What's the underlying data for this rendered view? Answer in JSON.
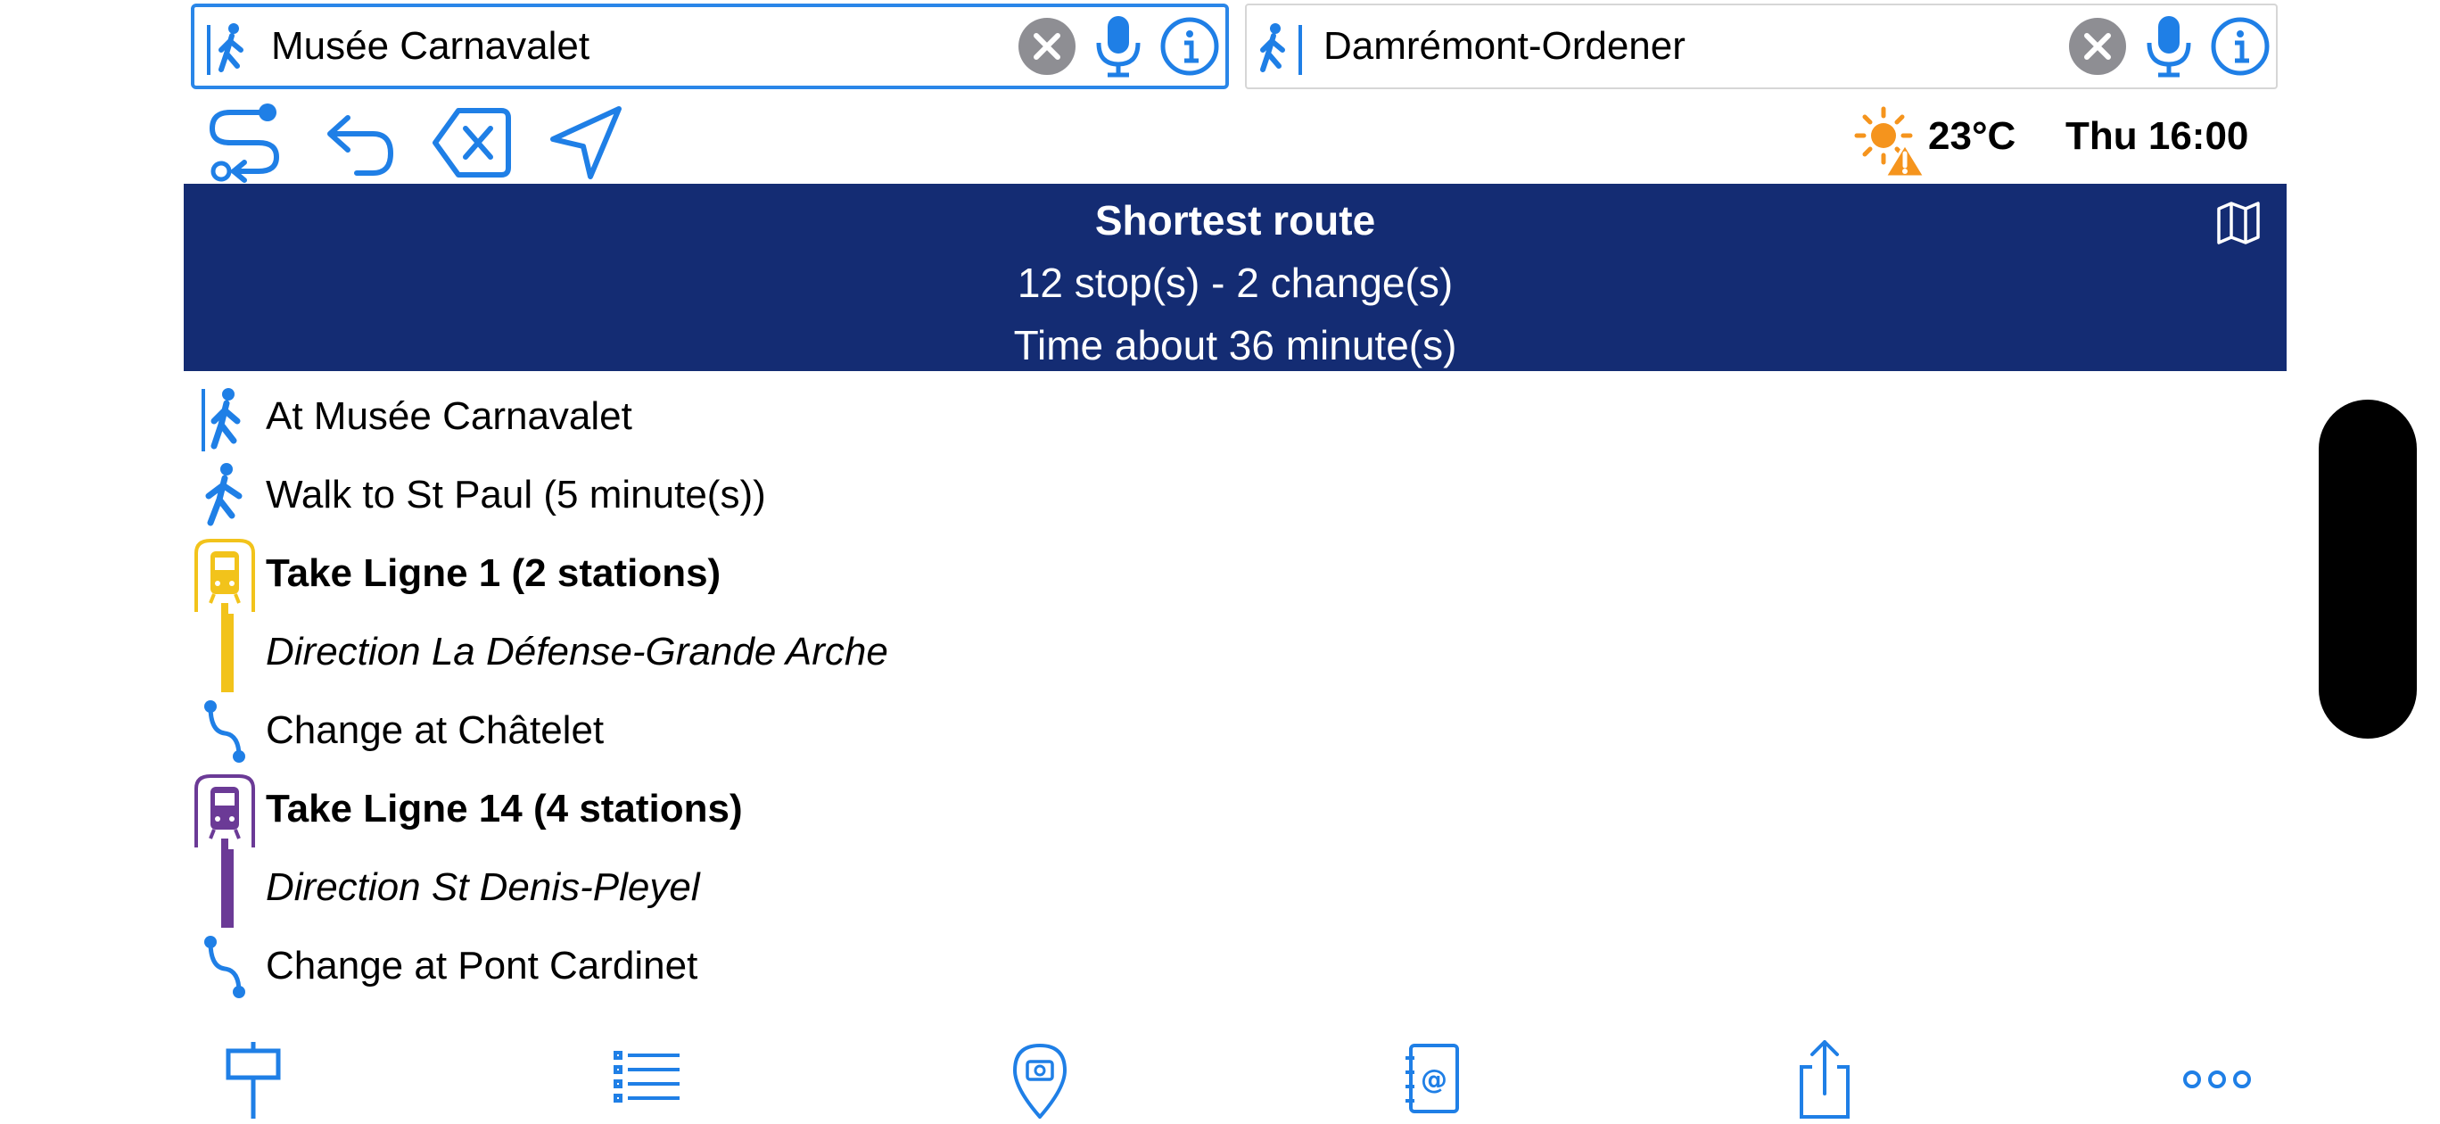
{
  "from_field": {
    "value": "Musée Carnavalet",
    "icon": "pedestrian-start-icon"
  },
  "to_field": {
    "value": "Damrémont-Ordener",
    "icon": "pedestrian-end-icon"
  },
  "toolbar": {
    "icons": [
      "route-icon",
      "undo-icon",
      "clear-icon",
      "locate-icon"
    ]
  },
  "weather": {
    "temperature": "23°C",
    "icon": "sun-warning-icon"
  },
  "datetime": "Thu 16:00",
  "route": {
    "title": "Shortest route",
    "summary": "12 stop(s) - 2 change(s)",
    "duration": "Time about 36 minute(s)"
  },
  "steps": [
    {
      "text": "At Musée Carnavalet",
      "style": "normal",
      "icon": "pedestrian-start-icon"
    },
    {
      "text": "Walk to St Paul (5 minute(s))",
      "style": "normal",
      "icon": "walk-icon"
    },
    {
      "text": "Take Ligne 1 (2 stations)",
      "style": "bold",
      "icon": "metro-icon",
      "color": "#f2c31b"
    },
    {
      "text": "Direction La Défense-Grande Arche",
      "style": "italic",
      "icon": "line-bar",
      "color": "#f2c31b"
    },
    {
      "text": "Change at Châtelet",
      "style": "normal",
      "icon": "change-icon"
    },
    {
      "text": "Take Ligne 14 (4 stations)",
      "style": "bold",
      "icon": "metro-icon",
      "color": "#6b3a96"
    },
    {
      "text": "Direction St Denis-Pleyel",
      "style": "italic",
      "icon": "line-bar",
      "color": "#6b3a96"
    },
    {
      "text": "Change at Pont Cardinet",
      "style": "normal",
      "icon": "change-icon"
    }
  ],
  "tabbar": {
    "icons": [
      "signpost-icon",
      "list-icon",
      "photo-pin-icon",
      "contacts-icon",
      "share-icon",
      "more-icon"
    ]
  },
  "colors": {
    "accent": "#1f7fe6",
    "banner": "#142c73",
    "line1": "#f2c31b",
    "line14": "#6b3a96",
    "sun": "#f5941d"
  }
}
